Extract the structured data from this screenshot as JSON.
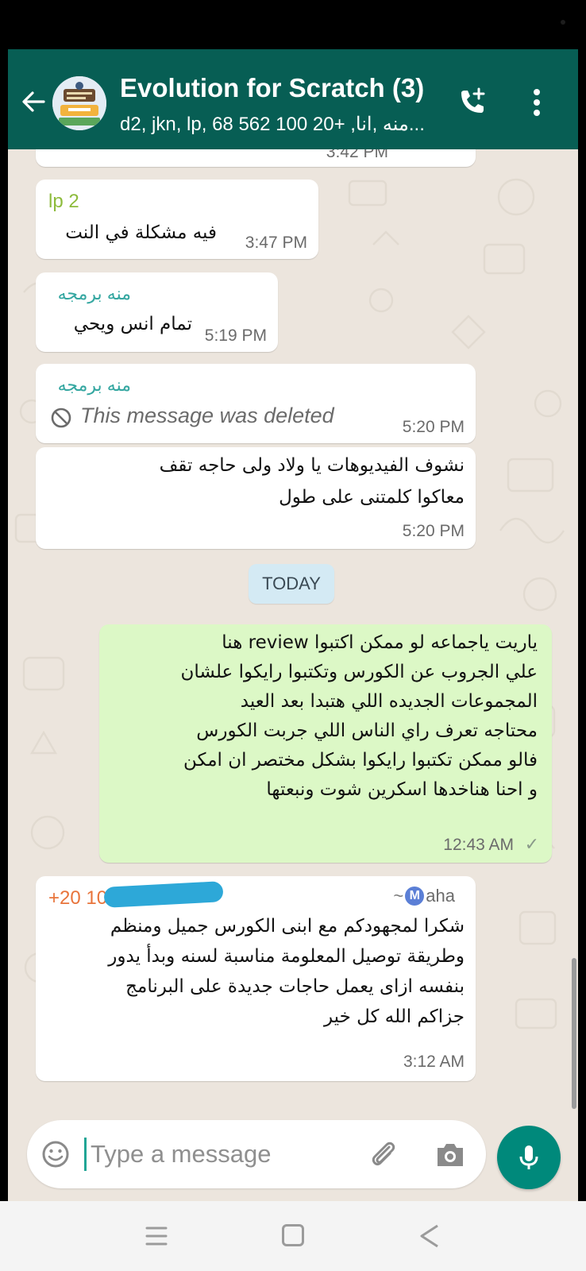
{
  "header": {
    "title": "Evolution for Scratch (3)",
    "subtitle": "d2, jkn, lp, منه ,انا, +20 100 562 68..."
  },
  "messages": {
    "m0": {
      "partial_time": "3:42 PM"
    },
    "m1": {
      "sender": "lp 2",
      "text": "فيه مشكلة في النت",
      "time": "3:47 PM"
    },
    "m2": {
      "sender": "منه برمجه",
      "text": "تمام انس ويحي",
      "time": "5:19 PM"
    },
    "m3": {
      "sender": "منه برمجه",
      "text": "This message was deleted",
      "time": "5:20 PM"
    },
    "m4": {
      "lines": [
        "نشوف الفيديوهات يا ولاد ولى حاجه تقف",
        "معاكوا كلمتنى على طول"
      ],
      "time": "5:20 PM"
    },
    "m5": {
      "lines": [
        "ياريت ياجماعه لو ممكن اكتبوا review هنا",
        "علي الجروب عن الكورس وتكتبوا رايكوا علشان",
        "المجموعات الجديده اللي هتبدا بعد العيد",
        "محتاجه تعرف راي الناس اللي جربت الكورس",
        "فالو ممكن تكتبوا رايكوا بشكل مختصر ان امكن",
        "و احنا هناخدها اسكرين شوت ونبعتها"
      ],
      "time": "12:43 AM",
      "status": "✓"
    },
    "m6": {
      "sender_phone": "+20 10",
      "sender_name": "aha",
      "sender_prefix": "~",
      "sender_badge": "M",
      "lines": [
        "شكرا لمجهودكم مع ابنى الكورس جميل ومنظم",
        "وطريقة توصيل المعلومة مناسبة لسنه وبدأ يدور",
        "بنفسه ازاى يعمل حاجات جديدة على البرنامج",
        "جزاكم الله كل خير"
      ],
      "time": "3:12 AM"
    }
  },
  "day_separator": "TODAY",
  "composer": {
    "placeholder": "Type a message"
  },
  "colors": {
    "header": "#075e54",
    "outgoing_bubble": "#dcf8c6",
    "chat_background": "#ece5dd",
    "sender_lp": "#8dbb3c",
    "sender_menna": "#35a7a1",
    "sender_maha": "#e8743b",
    "mic_button": "#00897b"
  },
  "icons": [
    "back-arrow-icon",
    "group-avatar",
    "add-call-icon",
    "more-vert-icon",
    "deleted-icon",
    "read-tick-icon",
    "emoji-icon",
    "attach-icon",
    "camera-icon",
    "mic-icon",
    "nav-recent-icon",
    "nav-home-icon",
    "nav-back-icon"
  ]
}
